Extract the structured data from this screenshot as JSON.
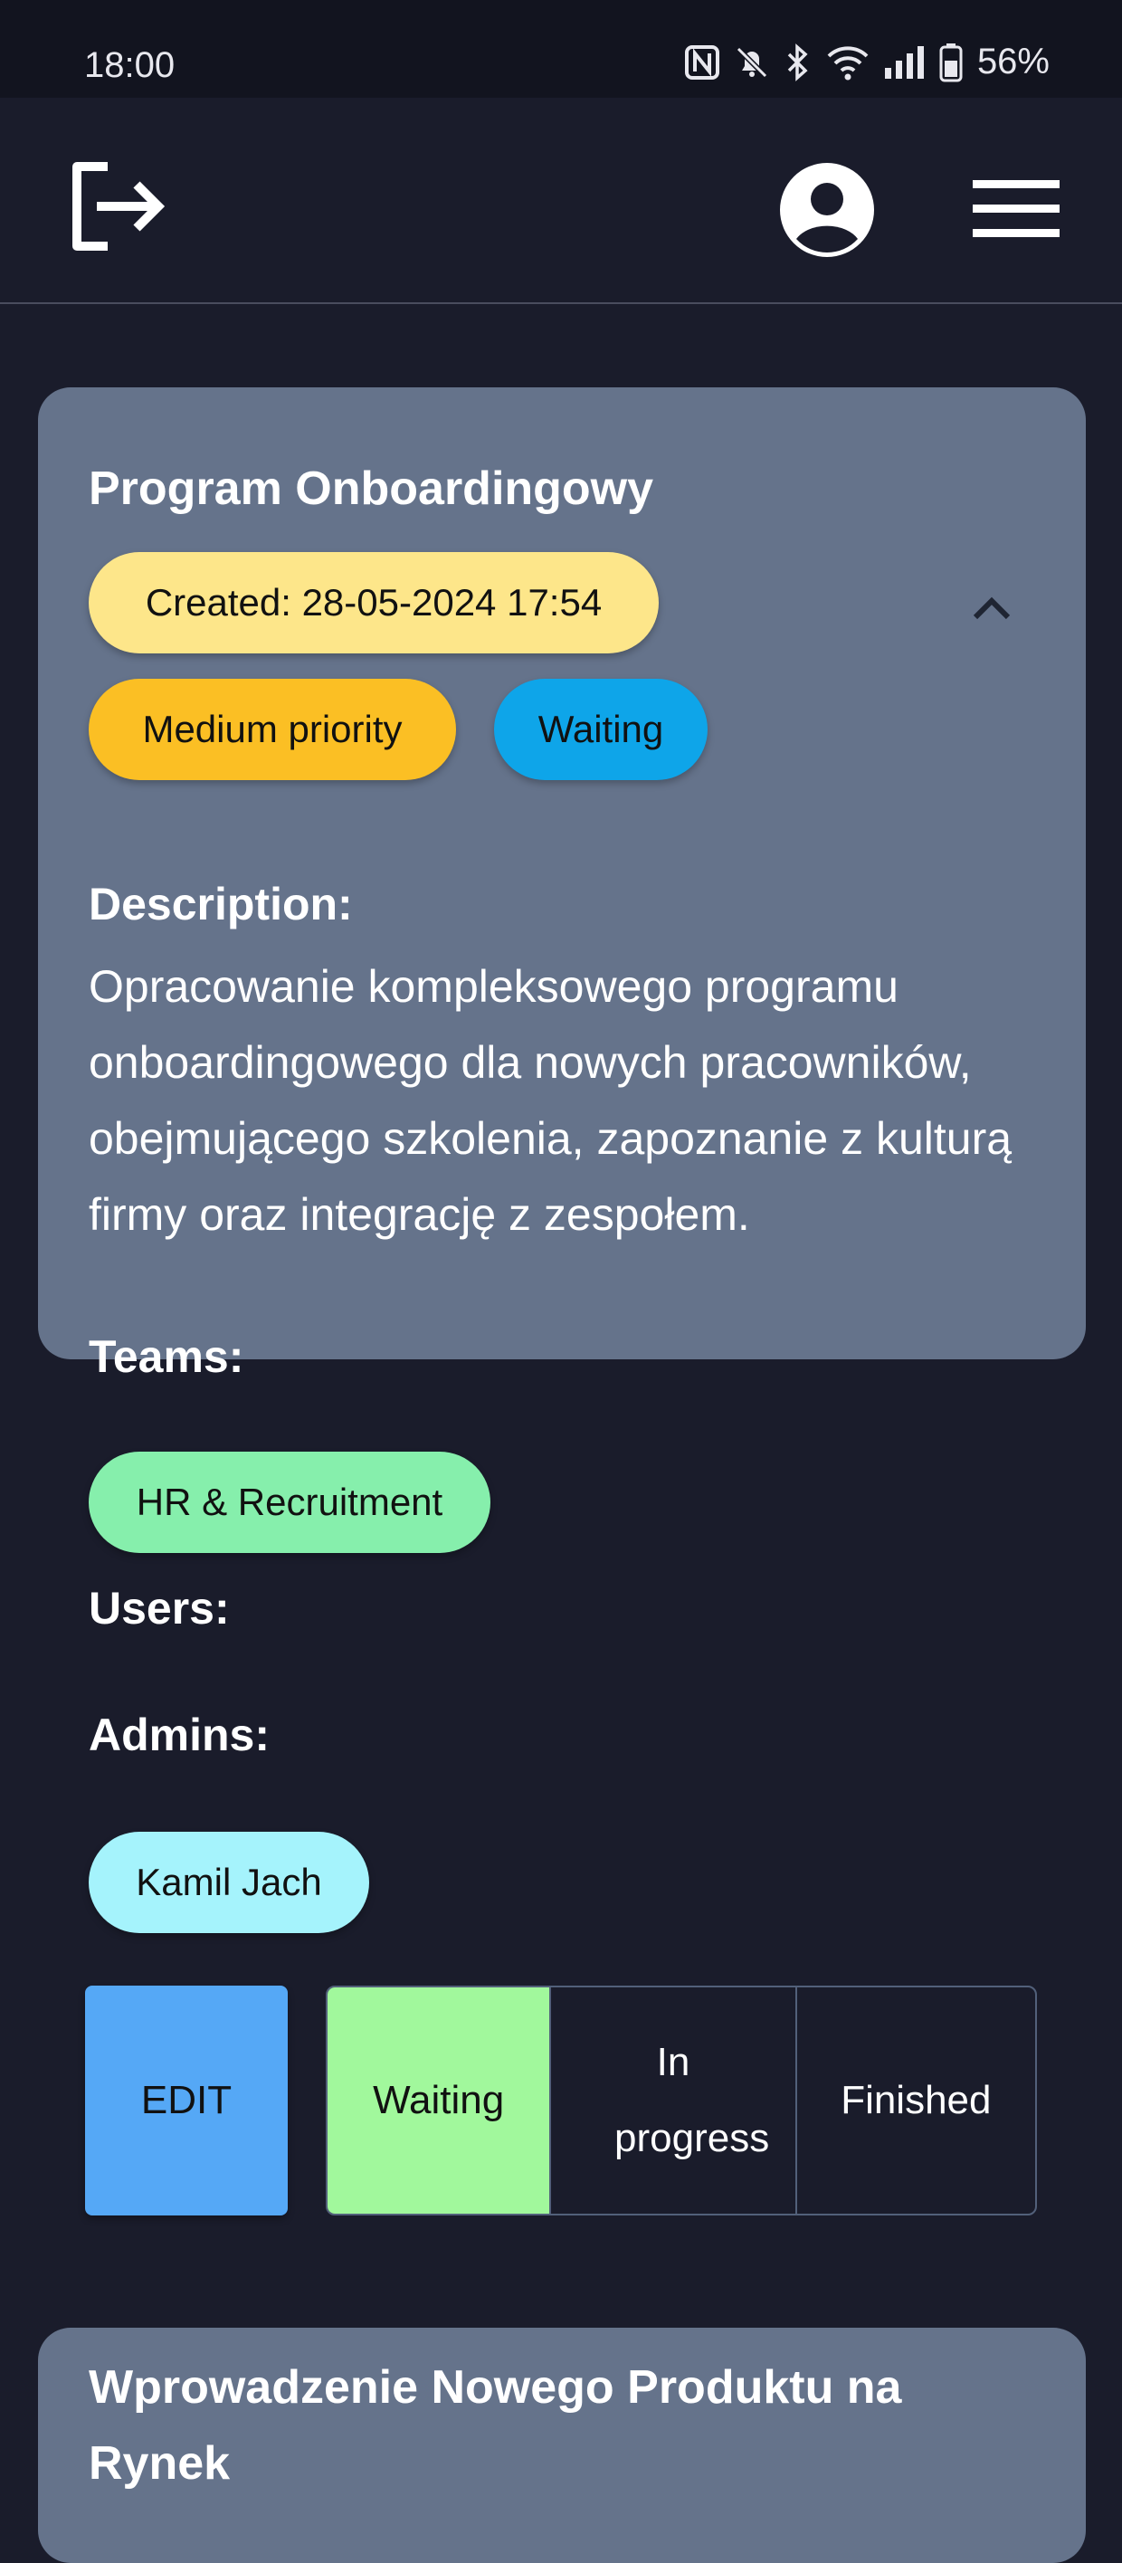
{
  "status_bar": {
    "time": "18:00",
    "battery": "56%",
    "icons": [
      "nfc-icon",
      "bell-muted-icon",
      "bluetooth-icon",
      "wifi-icon",
      "signal-icon",
      "battery-icon"
    ]
  },
  "header": {
    "icons": [
      "logout-icon",
      "account-circle-icon",
      "hamburger-menu-icon"
    ]
  },
  "tasks": [
    {
      "title": "Program Onboardingowy",
      "created": "Created: 28-05-2024 17:54",
      "priority": "Medium priority",
      "status_chip": "Waiting",
      "description_label": "Description:",
      "description": "Opracowanie kompleksowego programu onboardingowego dla nowych pracowników, obejmującego szkolenia, zapoznanie z kulturą firmy oraz integrację z zespołem.",
      "teams_label": "Teams:",
      "teams": [
        "HR & Recruitment"
      ],
      "users_label": "Users:",
      "users": [],
      "admins_label": "Admins:",
      "admins": [
        "Kamil Jach"
      ],
      "edit_label": "EDIT",
      "status_options": [
        "Waiting",
        "In progress",
        "Finished"
      ],
      "selected_status": "Waiting"
    },
    {
      "title": "Wprowadzenie Nowego Produktu na Rynek"
    }
  ],
  "colors": {
    "background": "#1a1c2b",
    "card": "#65738b",
    "created_chip": "#fde68a",
    "priority_chip": "#fbbf24",
    "status_chip": "#0ea5e9",
    "team_chip": "#86efac",
    "admin_chip": "#a5f3fc",
    "edit_button": "#55a8f6",
    "selected_status": "#a1f89c"
  }
}
